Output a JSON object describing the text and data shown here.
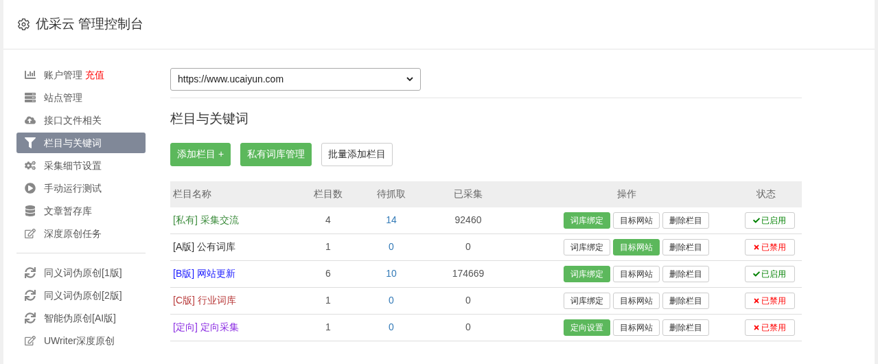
{
  "header": {
    "title": "优采云 管理控制台"
  },
  "sidebar": {
    "items": [
      {
        "kind": "account",
        "label": "账户管理",
        "badge": "充值",
        "selected": false
      },
      {
        "kind": "server",
        "label": "站点管理",
        "selected": false
      },
      {
        "kind": "upload",
        "label": "接口文件相关",
        "selected": false
      },
      {
        "kind": "filter",
        "label": "栏目与关键词",
        "selected": true
      },
      {
        "kind": "cogs",
        "label": "采集细节设置",
        "selected": false
      },
      {
        "kind": "play",
        "label": "手动运行测试",
        "selected": false
      },
      {
        "kind": "database",
        "label": "文章暂存库",
        "selected": false
      },
      {
        "kind": "edit",
        "label": "深度原创任务",
        "selected": false
      },
      {
        "kind": "divider"
      },
      {
        "kind": "refresh",
        "label": "同义词伪原创[1版]",
        "selected": false
      },
      {
        "kind": "refresh",
        "label": "同义词伪原创[2版]",
        "selected": false
      },
      {
        "kind": "refresh",
        "label": "智能伪原创[AI版]",
        "selected": false
      },
      {
        "kind": "edit",
        "label": "UWriter深度原创",
        "selected": false
      }
    ]
  },
  "site_select": {
    "value": "https://www.ucaiyun.com"
  },
  "section_title": "栏目与关键词",
  "toolbar": [
    {
      "label": "添加栏目 +",
      "primary": true
    },
    {
      "label": "私有词库管理",
      "primary": true
    },
    {
      "label": "批量添加栏目",
      "primary": false
    }
  ],
  "table": {
    "columns": [
      "栏目名称",
      "栏目数",
      "待抓取",
      "已采集",
      "操作",
      "状态"
    ],
    "rows": [
      {
        "tag": "[私有]",
        "name": "采集交流",
        "color": "#3c8c3c",
        "count": "4",
        "pending": "14",
        "collected": "92460",
        "actions": [
          {
            "label": "词库绑定",
            "primary": true
          },
          {
            "label": "目标网站",
            "primary": false
          },
          {
            "label": "删除栏目",
            "primary": false
          }
        ],
        "status": {
          "label": "已启用",
          "enabled": true
        }
      },
      {
        "tag": "[A版]",
        "name": "公有词库",
        "color": "#333333",
        "count": "1",
        "pending": "0",
        "collected": "0",
        "actions": [
          {
            "label": "词库绑定",
            "primary": false
          },
          {
            "label": "目标网站",
            "primary": true
          },
          {
            "label": "删除栏目",
            "primary": false
          }
        ],
        "status": {
          "label": "已禁用",
          "enabled": false
        }
      },
      {
        "tag": "[B版]",
        "name": "网站更新",
        "color": "#1a1aff",
        "count": "6",
        "pending": "10",
        "collected": "174669",
        "actions": [
          {
            "label": "词库绑定",
            "primary": true
          },
          {
            "label": "目标网站",
            "primary": false
          },
          {
            "label": "删除栏目",
            "primary": false
          }
        ],
        "status": {
          "label": "已启用",
          "enabled": true
        }
      },
      {
        "tag": "[C版]",
        "name": "行业词库",
        "color": "#b83a3a",
        "count": "1",
        "pending": "0",
        "collected": "0",
        "actions": [
          {
            "label": "词库绑定",
            "primary": false
          },
          {
            "label": "目标网站",
            "primary": false
          },
          {
            "label": "删除栏目",
            "primary": false
          }
        ],
        "status": {
          "label": "已禁用",
          "enabled": false
        }
      },
      {
        "tag": "[定向]",
        "name": "定向采集",
        "color": "#8a2be2",
        "count": "1",
        "pending": "0",
        "collected": "0",
        "actions": [
          {
            "label": "定向设置",
            "primary": true
          },
          {
            "label": "目标网站",
            "primary": false
          },
          {
            "label": "删除栏目",
            "primary": false
          }
        ],
        "status": {
          "label": "已禁用",
          "enabled": false
        }
      }
    ]
  }
}
